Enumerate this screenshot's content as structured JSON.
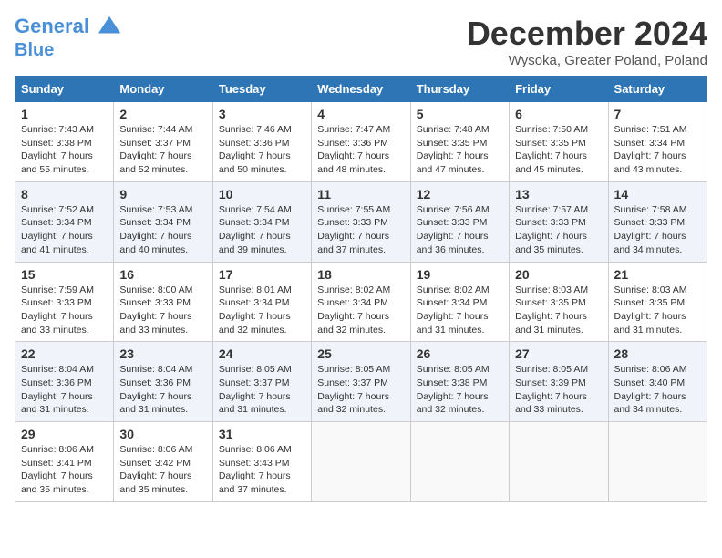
{
  "header": {
    "logo_line1": "General",
    "logo_line2": "Blue",
    "title": "December 2024",
    "subtitle": "Wysoka, Greater Poland, Poland"
  },
  "weekdays": [
    "Sunday",
    "Monday",
    "Tuesday",
    "Wednesday",
    "Thursday",
    "Friday",
    "Saturday"
  ],
  "weeks": [
    [
      {
        "day": "1",
        "sunrise": "7:43 AM",
        "sunset": "3:38 PM",
        "daylight": "7 hours and 55 minutes."
      },
      {
        "day": "2",
        "sunrise": "7:44 AM",
        "sunset": "3:37 PM",
        "daylight": "7 hours and 52 minutes."
      },
      {
        "day": "3",
        "sunrise": "7:46 AM",
        "sunset": "3:36 PM",
        "daylight": "7 hours and 50 minutes."
      },
      {
        "day": "4",
        "sunrise": "7:47 AM",
        "sunset": "3:36 PM",
        "daylight": "7 hours and 48 minutes."
      },
      {
        "day": "5",
        "sunrise": "7:48 AM",
        "sunset": "3:35 PM",
        "daylight": "7 hours and 47 minutes."
      },
      {
        "day": "6",
        "sunrise": "7:50 AM",
        "sunset": "3:35 PM",
        "daylight": "7 hours and 45 minutes."
      },
      {
        "day": "7",
        "sunrise": "7:51 AM",
        "sunset": "3:34 PM",
        "daylight": "7 hours and 43 minutes."
      }
    ],
    [
      {
        "day": "8",
        "sunrise": "7:52 AM",
        "sunset": "3:34 PM",
        "daylight": "7 hours and 41 minutes."
      },
      {
        "day": "9",
        "sunrise": "7:53 AM",
        "sunset": "3:34 PM",
        "daylight": "7 hours and 40 minutes."
      },
      {
        "day": "10",
        "sunrise": "7:54 AM",
        "sunset": "3:34 PM",
        "daylight": "7 hours and 39 minutes."
      },
      {
        "day": "11",
        "sunrise": "7:55 AM",
        "sunset": "3:33 PM",
        "daylight": "7 hours and 37 minutes."
      },
      {
        "day": "12",
        "sunrise": "7:56 AM",
        "sunset": "3:33 PM",
        "daylight": "7 hours and 36 minutes."
      },
      {
        "day": "13",
        "sunrise": "7:57 AM",
        "sunset": "3:33 PM",
        "daylight": "7 hours and 35 minutes."
      },
      {
        "day": "14",
        "sunrise": "7:58 AM",
        "sunset": "3:33 PM",
        "daylight": "7 hours and 34 minutes."
      }
    ],
    [
      {
        "day": "15",
        "sunrise": "7:59 AM",
        "sunset": "3:33 PM",
        "daylight": "7 hours and 33 minutes."
      },
      {
        "day": "16",
        "sunrise": "8:00 AM",
        "sunset": "3:33 PM",
        "daylight": "7 hours and 33 minutes."
      },
      {
        "day": "17",
        "sunrise": "8:01 AM",
        "sunset": "3:34 PM",
        "daylight": "7 hours and 32 minutes."
      },
      {
        "day": "18",
        "sunrise": "8:02 AM",
        "sunset": "3:34 PM",
        "daylight": "7 hours and 32 minutes."
      },
      {
        "day": "19",
        "sunrise": "8:02 AM",
        "sunset": "3:34 PM",
        "daylight": "7 hours and 31 minutes."
      },
      {
        "day": "20",
        "sunrise": "8:03 AM",
        "sunset": "3:35 PM",
        "daylight": "7 hours and 31 minutes."
      },
      {
        "day": "21",
        "sunrise": "8:03 AM",
        "sunset": "3:35 PM",
        "daylight": "7 hours and 31 minutes."
      }
    ],
    [
      {
        "day": "22",
        "sunrise": "8:04 AM",
        "sunset": "3:36 PM",
        "daylight": "7 hours and 31 minutes."
      },
      {
        "day": "23",
        "sunrise": "8:04 AM",
        "sunset": "3:36 PM",
        "daylight": "7 hours and 31 minutes."
      },
      {
        "day": "24",
        "sunrise": "8:05 AM",
        "sunset": "3:37 PM",
        "daylight": "7 hours and 31 minutes."
      },
      {
        "day": "25",
        "sunrise": "8:05 AM",
        "sunset": "3:37 PM",
        "daylight": "7 hours and 32 minutes."
      },
      {
        "day": "26",
        "sunrise": "8:05 AM",
        "sunset": "3:38 PM",
        "daylight": "7 hours and 32 minutes."
      },
      {
        "day": "27",
        "sunrise": "8:05 AM",
        "sunset": "3:39 PM",
        "daylight": "7 hours and 33 minutes."
      },
      {
        "day": "28",
        "sunrise": "8:06 AM",
        "sunset": "3:40 PM",
        "daylight": "7 hours and 34 minutes."
      }
    ],
    [
      {
        "day": "29",
        "sunrise": "8:06 AM",
        "sunset": "3:41 PM",
        "daylight": "7 hours and 35 minutes."
      },
      {
        "day": "30",
        "sunrise": "8:06 AM",
        "sunset": "3:42 PM",
        "daylight": "7 hours and 35 minutes."
      },
      {
        "day": "31",
        "sunrise": "8:06 AM",
        "sunset": "3:43 PM",
        "daylight": "7 hours and 37 minutes."
      },
      null,
      null,
      null,
      null
    ]
  ]
}
